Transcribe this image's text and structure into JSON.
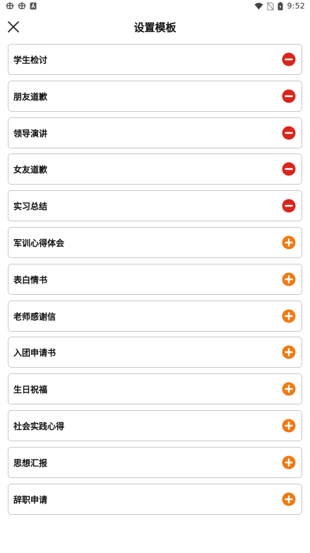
{
  "status_bar": {
    "time": "9:52",
    "left_icons": [
      "bug-icon",
      "bug-icon",
      "notification-a-icon"
    ],
    "right_icons": [
      "wifi-icon",
      "no-sim-icon",
      "battery-icon"
    ]
  },
  "header": {
    "title": "设置模板",
    "close_icon": "close-icon"
  },
  "colors": {
    "remove": "#d9261c",
    "add": "#f07a14",
    "border": "#c8c8c8"
  },
  "templates": [
    {
      "label": "学生检讨",
      "action": "remove"
    },
    {
      "label": "朋友道歉",
      "action": "remove"
    },
    {
      "label": "领导演讲",
      "action": "remove"
    },
    {
      "label": "女友道歉",
      "action": "remove"
    },
    {
      "label": "实习总结",
      "action": "remove"
    },
    {
      "label": "军训心得体会",
      "action": "add"
    },
    {
      "label": "表白情书",
      "action": "add"
    },
    {
      "label": "老师感谢信",
      "action": "add"
    },
    {
      "label": "入团申请书",
      "action": "add"
    },
    {
      "label": "生日祝福",
      "action": "add"
    },
    {
      "label": "社会实践心得",
      "action": "add"
    },
    {
      "label": "思想汇报",
      "action": "add"
    },
    {
      "label": "辞职申请",
      "action": "add"
    }
  ]
}
